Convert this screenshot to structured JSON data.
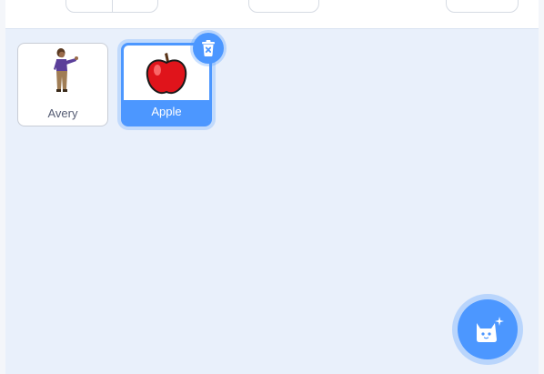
{
  "sprites": [
    {
      "name": "Avery",
      "selected": false,
      "thumbnail_icon": "avery-figure-icon"
    },
    {
      "name": "Apple",
      "selected": true,
      "thumbnail_icon": "apple-icon"
    }
  ],
  "controls": {
    "delete_icon": "trash-icon",
    "choose_sprite_icon": "cat-sparkle-icon"
  },
  "colors": {
    "accent": "#4c97ff",
    "pane_background": "#e9f0fb",
    "label_text": "#575e75"
  }
}
